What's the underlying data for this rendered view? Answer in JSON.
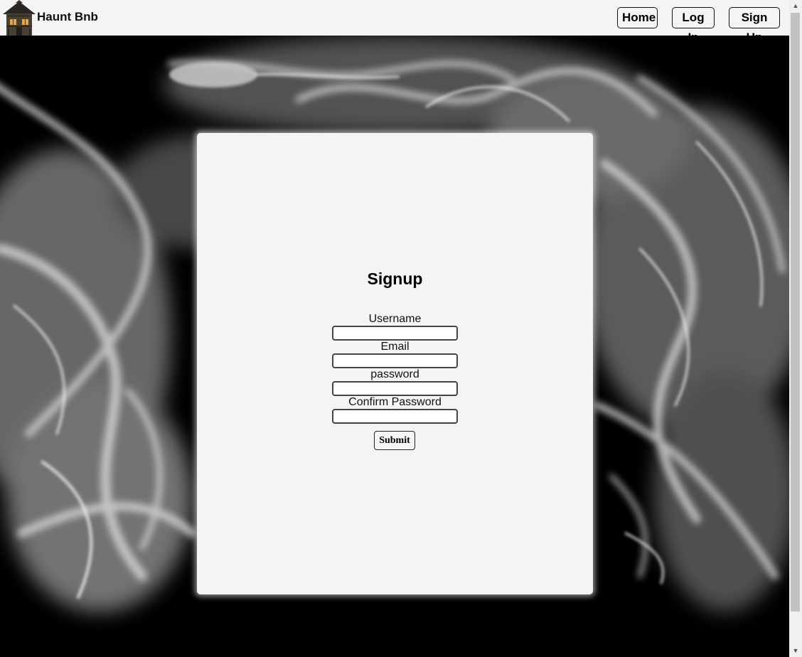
{
  "header": {
    "brand": "Haunt Bnb",
    "nav": {
      "home": "Home",
      "login": "Log In",
      "signup": "Sign Up"
    }
  },
  "form": {
    "title": "Signup",
    "fields": {
      "username": {
        "label": "Username",
        "value": ""
      },
      "email": {
        "label": "Email",
        "value": ""
      },
      "password": {
        "label": "password",
        "value": ""
      },
      "confirm_password": {
        "label": "Confirm Password",
        "value": ""
      }
    },
    "submit_label": "Submit"
  },
  "colors": {
    "header_bg": "#f4f4f4",
    "card_bg": "#f4f4f4",
    "background": "#000000"
  },
  "icons": {
    "logo": "haunted-house-icon",
    "scroll_up": "scroll-up-arrow-icon",
    "scroll_down": "scroll-down-arrow-icon"
  }
}
